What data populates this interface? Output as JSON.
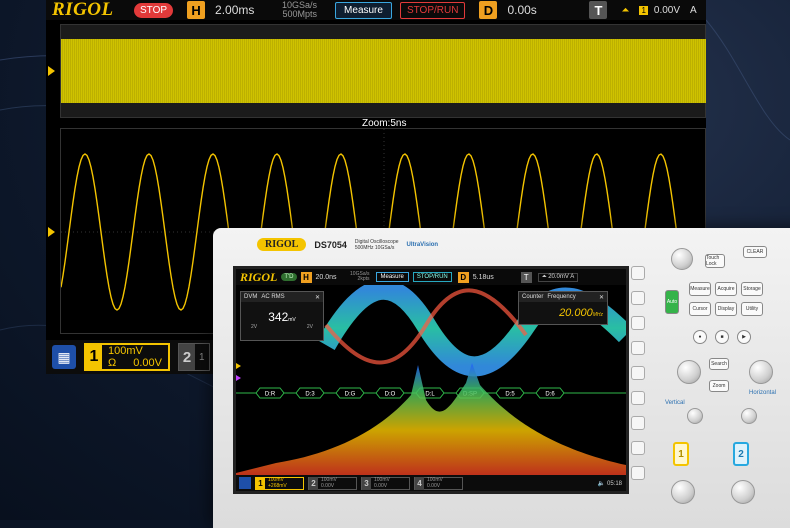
{
  "colors": {
    "channel1": "#f4c400",
    "channel2": "#27a8e0",
    "stop": "#e23a3a",
    "horizontal": "#f0a020",
    "measure_border": "#3aa7e0"
  },
  "main_screen": {
    "brand": "RIGOL",
    "run_state": "STOP",
    "horizontal_key": "H",
    "timebase": "2.00ms",
    "sample_rate": "10GSa/s",
    "memory_depth": "500Mpts",
    "measure_button": "Measure",
    "stoprun_button": "STOP/RUN",
    "delay_key": "D",
    "delay": "0.00s",
    "trigger_key": "T",
    "trigger_channel": "1",
    "trigger_level": "0.00V",
    "trigger_mode": "A",
    "zoom_label": "Zoom:5ns",
    "channels": [
      {
        "num": "1",
        "scale": "100mV",
        "coupling_icon": "Ω",
        "offset": "0.00V"
      },
      {
        "num": "2",
        "scale": "1"
      }
    ]
  },
  "device": {
    "brand": "RIGOL",
    "model": "DS7054",
    "subtitle_line1": "Digital Oscilloscope",
    "subtitle_line2": "500MHz 10GSa/s",
    "technology": "UltraVision"
  },
  "small_screen": {
    "brand": "RIGOL",
    "mode": "T'D",
    "horizontal_key": "H",
    "timebase": "20.0ns",
    "sample_rate": "10GSa/s",
    "memory_depth": "2kpts",
    "measure_button": "Measure",
    "stoprun_button": "STOP/RUN",
    "delay_key": "D",
    "delay": "5.18us",
    "trigger_key": "T",
    "trigger_level": "20.0mV",
    "trigger_mode": "A",
    "dvm": {
      "title": "DVM",
      "mode": "AC RMS",
      "value": "342",
      "unit": "mV",
      "scale_left": "2V",
      "scale_right": "2V"
    },
    "counter": {
      "title": "Counter",
      "mode": "Frequency",
      "value": "20.000",
      "unit": "MHz"
    },
    "bus_labels": [
      "D:R",
      "D:3",
      "D:G",
      "D:O",
      "D:L",
      "D:SP",
      "D:5",
      "D:6"
    ],
    "channels": [
      {
        "num": "1",
        "line1": "100mV",
        "line2": "+268mV"
      },
      {
        "num": "2",
        "line1": "100mV",
        "line2": "0.00V"
      },
      {
        "num": "3",
        "line1": "100mV",
        "line2": "0.00V"
      },
      {
        "num": "4",
        "line1": "100mV",
        "line2": "0.00V"
      }
    ],
    "time": "05:18"
  },
  "front_panel": {
    "clear": "CLEAR",
    "touch_lock": "Touch Lock",
    "auto": "Auto",
    "buttons": [
      "Measure",
      "Acquire",
      "Storage",
      "Cursor",
      "Display",
      "Utility"
    ],
    "search": "Search",
    "zoom": "Zoom",
    "horizontal": "Horizontal",
    "vertical": "Vertical",
    "channel_keys": [
      "1",
      "2"
    ]
  }
}
